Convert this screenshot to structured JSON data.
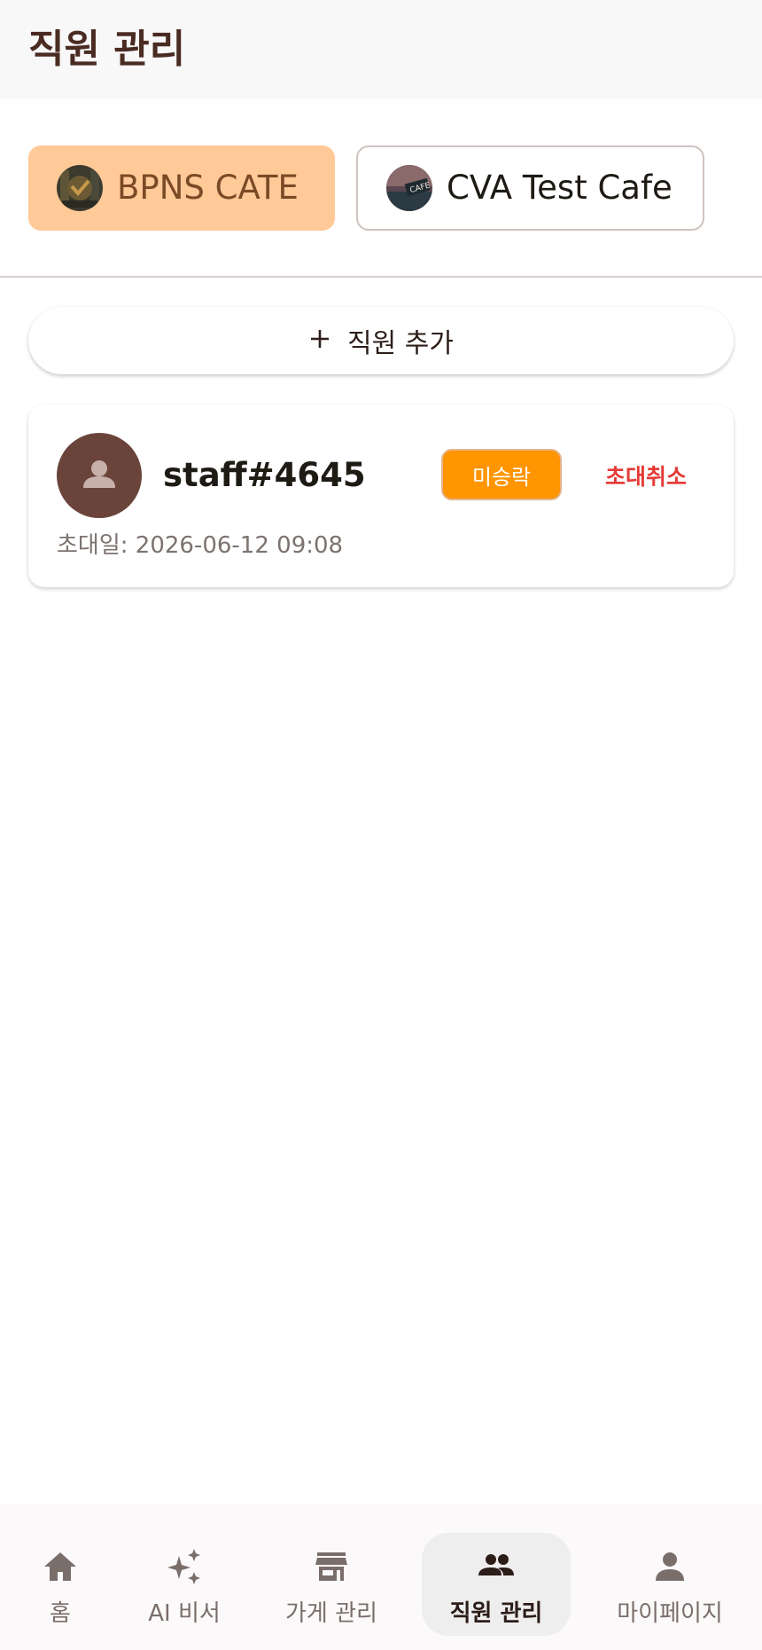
{
  "app_bar": {
    "title": "직원 관리"
  },
  "stores": [
    {
      "name": "BPNS CATE",
      "selected": true,
      "avatar": "store-photo"
    },
    {
      "name": "CVA Test Cafe",
      "selected": false,
      "avatar": "store-photo"
    }
  ],
  "add_staff": {
    "icon": "plus-icon",
    "label": "직원 추가"
  },
  "staff": [
    {
      "name": "staff#4645",
      "avatar_icon": "person-icon",
      "status": "미승락",
      "action": "초대취소",
      "invite_date": "초대일: 2026-06-12 09:08"
    }
  ],
  "bottom_nav": {
    "items": [
      {
        "label": "홈",
        "icon": "home-icon",
        "active": false
      },
      {
        "label": "AI 비서",
        "icon": "sparkle-icon",
        "active": false
      },
      {
        "label": "가게 관리",
        "icon": "store-icon",
        "active": false
      },
      {
        "label": "직원 관리",
        "icon": "group-icon",
        "active": true
      },
      {
        "label": "마이페이지",
        "icon": "person-icon",
        "active": false
      }
    ]
  },
  "colors": {
    "title": "#4a2b22",
    "chip_selected": "#ffc998",
    "badge": "#ff9500",
    "cancel": "#e53935",
    "avatar": "#6a443a"
  }
}
